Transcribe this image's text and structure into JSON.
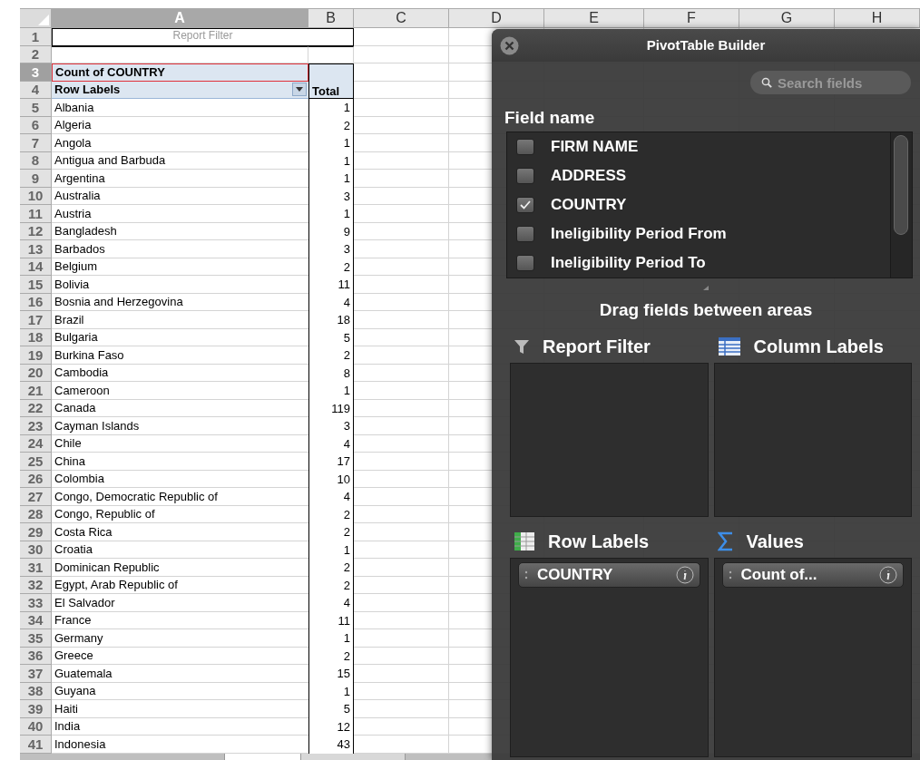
{
  "columns": [
    {
      "label": "A",
      "selected": true
    },
    {
      "label": "B",
      "selected": false
    },
    {
      "label": "C",
      "selected": false
    },
    {
      "label": "D",
      "selected": false
    },
    {
      "label": "E",
      "selected": false
    },
    {
      "label": "F",
      "selected": false
    },
    {
      "label": "G",
      "selected": false
    },
    {
      "label": "H",
      "selected": false
    }
  ],
  "row_headers": [
    {
      "label": "1",
      "selected": false
    },
    {
      "label": "2",
      "selected": false
    },
    {
      "label": "3",
      "selected": true
    },
    {
      "label": "4",
      "selected": false
    },
    {
      "label": "5",
      "selected": false
    },
    {
      "label": "6",
      "selected": false
    },
    {
      "label": "7",
      "selected": false
    },
    {
      "label": "8",
      "selected": false
    },
    {
      "label": "9",
      "selected": false
    },
    {
      "label": "10",
      "selected": false
    },
    {
      "label": "11",
      "selected": false
    },
    {
      "label": "12",
      "selected": false
    },
    {
      "label": "13",
      "selected": false
    },
    {
      "label": "14",
      "selected": false
    },
    {
      "label": "15",
      "selected": false
    },
    {
      "label": "16",
      "selected": false
    },
    {
      "label": "17",
      "selected": false
    },
    {
      "label": "18",
      "selected": false
    },
    {
      "label": "19",
      "selected": false
    },
    {
      "label": "20",
      "selected": false
    },
    {
      "label": "21",
      "selected": false
    },
    {
      "label": "22",
      "selected": false
    },
    {
      "label": "23",
      "selected": false
    },
    {
      "label": "24",
      "selected": false
    },
    {
      "label": "25",
      "selected": false
    },
    {
      "label": "26",
      "selected": false
    },
    {
      "label": "27",
      "selected": false
    },
    {
      "label": "28",
      "selected": false
    },
    {
      "label": "29",
      "selected": false
    },
    {
      "label": "30",
      "selected": false
    },
    {
      "label": "31",
      "selected": false
    },
    {
      "label": "32",
      "selected": false
    },
    {
      "label": "33",
      "selected": false
    },
    {
      "label": "34",
      "selected": false
    },
    {
      "label": "35",
      "selected": false
    },
    {
      "label": "36",
      "selected": false
    },
    {
      "label": "37",
      "selected": false
    },
    {
      "label": "38",
      "selected": false
    },
    {
      "label": "39",
      "selected": false
    },
    {
      "label": "40",
      "selected": false
    },
    {
      "label": "41",
      "selected": false
    }
  ],
  "pivot": {
    "report_filter": "Report Filter",
    "value_header": "Count of COUNTRY",
    "row_labels_header": "Row Labels",
    "total_header": "Total",
    "rows": [
      {
        "label": "Albania",
        "total": "1"
      },
      {
        "label": "Algeria",
        "total": "2"
      },
      {
        "label": "Angola",
        "total": "1"
      },
      {
        "label": "Antigua and Barbuda",
        "total": "1"
      },
      {
        "label": "Argentina",
        "total": "1"
      },
      {
        "label": "Australia",
        "total": "3"
      },
      {
        "label": "Austria",
        "total": "1"
      },
      {
        "label": "Bangladesh",
        "total": "9"
      },
      {
        "label": "Barbados",
        "total": "3"
      },
      {
        "label": "Belgium",
        "total": "2"
      },
      {
        "label": "Bolivia",
        "total": "11"
      },
      {
        "label": "Bosnia and Herzegovina",
        "total": "4"
      },
      {
        "label": "Brazil",
        "total": "18"
      },
      {
        "label": "Bulgaria",
        "total": "5"
      },
      {
        "label": "Burkina Faso",
        "total": "2"
      },
      {
        "label": "Cambodia",
        "total": "8"
      },
      {
        "label": "Cameroon",
        "total": "1"
      },
      {
        "label": "Canada",
        "total": "119"
      },
      {
        "label": "Cayman Islands",
        "total": "3"
      },
      {
        "label": "Chile",
        "total": "4"
      },
      {
        "label": "China",
        "total": "17"
      },
      {
        "label": "Colombia",
        "total": "10"
      },
      {
        "label": "Congo, Democratic Republic of",
        "total": "4"
      },
      {
        "label": "Congo, Republic of",
        "total": "2"
      },
      {
        "label": "Costa Rica",
        "total": "2"
      },
      {
        "label": "Croatia",
        "total": "1"
      },
      {
        "label": "Dominican Republic",
        "total": "2"
      },
      {
        "label": "Egypt, Arab Republic of",
        "total": "2"
      },
      {
        "label": "El Salvador",
        "total": "4"
      },
      {
        "label": "France",
        "total": "11"
      },
      {
        "label": "Germany",
        "total": "1"
      },
      {
        "label": "Greece",
        "total": "2"
      },
      {
        "label": "Guatemala",
        "total": "15"
      },
      {
        "label": "Guyana",
        "total": "1"
      },
      {
        "label": "Haiti",
        "total": "5"
      },
      {
        "label": "India",
        "total": "12"
      },
      {
        "label": "Indonesia",
        "total": "43"
      }
    ]
  },
  "builder": {
    "title": "PivotTable Builder",
    "search": {
      "placeholder": "Search fields"
    },
    "fields_title": "Field name",
    "fields": [
      {
        "name": "FIRM NAME",
        "checked": false
      },
      {
        "name": "ADDRESS",
        "checked": false
      },
      {
        "name": "COUNTRY",
        "checked": true
      },
      {
        "name": "Ineligibility Period From",
        "checked": false
      },
      {
        "name": "Ineligibility Period To",
        "checked": false
      }
    ],
    "hint": "Drag fields between areas",
    "areas": [
      {
        "kind": "filter",
        "title": "Report Filter"
      },
      {
        "kind": "columns",
        "title": "Column Labels"
      },
      {
        "kind": "rows",
        "title": "Row Labels",
        "items": [
          "COUNTRY"
        ]
      },
      {
        "kind": "values",
        "title": "Values",
        "items": [
          "Count of..."
        ]
      }
    ]
  }
}
